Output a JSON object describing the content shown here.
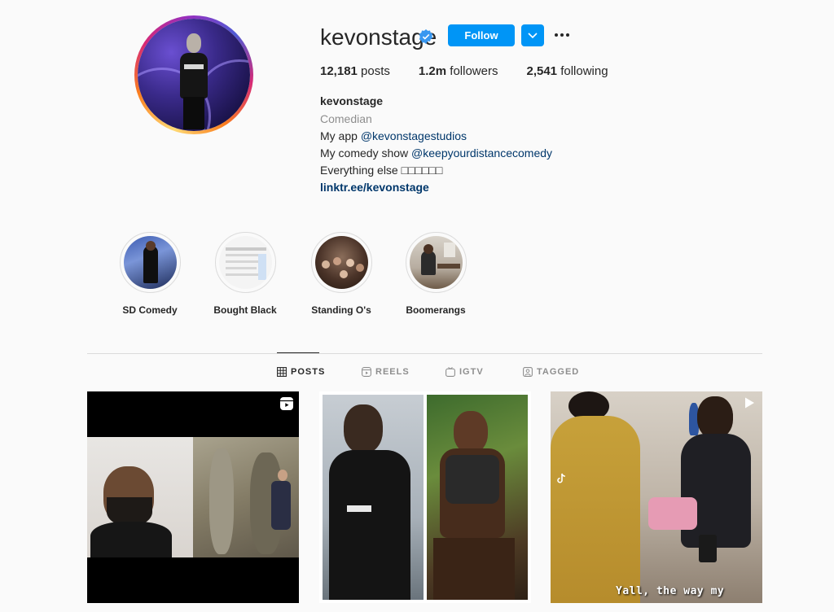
{
  "profile": {
    "username": "kevonstage",
    "follow_label": "Follow",
    "stats": {
      "posts_count": "12,181",
      "posts_label": " posts",
      "followers_count": "1.2m",
      "followers_label": " followers",
      "following_count": "2,541",
      "following_label": " following"
    },
    "bio": {
      "name": "kevonstage",
      "category": "Comedian",
      "line1_prefix": "My app ",
      "line1_mention": "@kevonstagestudios",
      "line2_prefix": "My comedy show ",
      "line2_mention": "@keepyourdistancecomedy",
      "line3": "Everything else □□□□□□",
      "link": "linktr.ee/kevonstage"
    }
  },
  "highlights": [
    {
      "label": "SD Comedy"
    },
    {
      "label": "Bought Black"
    },
    {
      "label": "Standing O's"
    },
    {
      "label": "Boomerangs"
    }
  ],
  "tabs": [
    {
      "label": "POSTS",
      "icon": "grid-icon",
      "active": true
    },
    {
      "label": "REELS",
      "icon": "reels-icon",
      "active": false
    },
    {
      "label": "IGTV",
      "icon": "igtv-icon",
      "active": false
    },
    {
      "label": "TAGGED",
      "icon": "tagged-icon",
      "active": false
    }
  ],
  "posts": [
    {
      "type": "reel",
      "icon": "reels-icon"
    },
    {
      "type": "image"
    },
    {
      "type": "video",
      "icon": "play-icon",
      "caption": "Yall, the way my"
    }
  ],
  "colors": {
    "accent": "#0095f6",
    "link": "#00376b",
    "muted": "#8e8e8e",
    "text": "#262626",
    "background": "#fafafa"
  }
}
